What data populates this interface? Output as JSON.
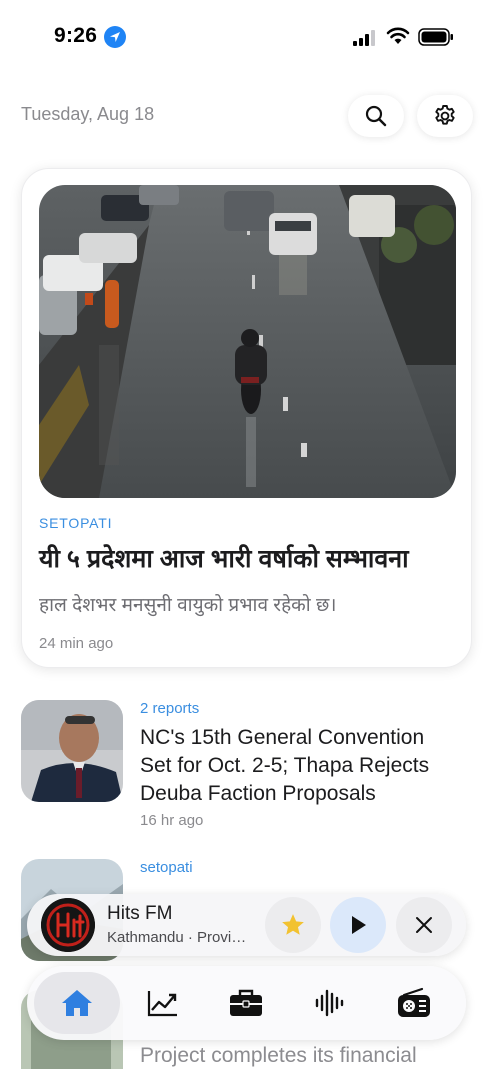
{
  "status_bar": {
    "time": "9:26"
  },
  "header": {
    "date": "Tuesday, Aug 18"
  },
  "featured": {
    "source": "SETOPATI",
    "title": "यी ५ प्रदेशमा आज भारी वर्षाको सम्भावना",
    "summary": "हाल देशभर मनसुनी वायुको प्रभाव रहेको छ।",
    "time": "24 min ago"
  },
  "articles": [
    {
      "meta": "2 reports",
      "title": "NC's 15th General Convention Set for Oct. 2-5; Thapa Rejects Deuba Faction Proposals",
      "time": "16 hr ago"
    },
    {
      "meta": "setopati",
      "title": "",
      "time": ""
    },
    {
      "meta": "",
      "title": "Project completes its financial",
      "time": ""
    }
  ],
  "player": {
    "station": "Hits FM",
    "subtitle": "Kathmandu · Provi…"
  },
  "tabs": [
    "home",
    "markets",
    "business",
    "audio",
    "radio"
  ],
  "colors": {
    "accent": "#3a8ee0",
    "location": "#1f84f5",
    "star": "#f2c230"
  }
}
